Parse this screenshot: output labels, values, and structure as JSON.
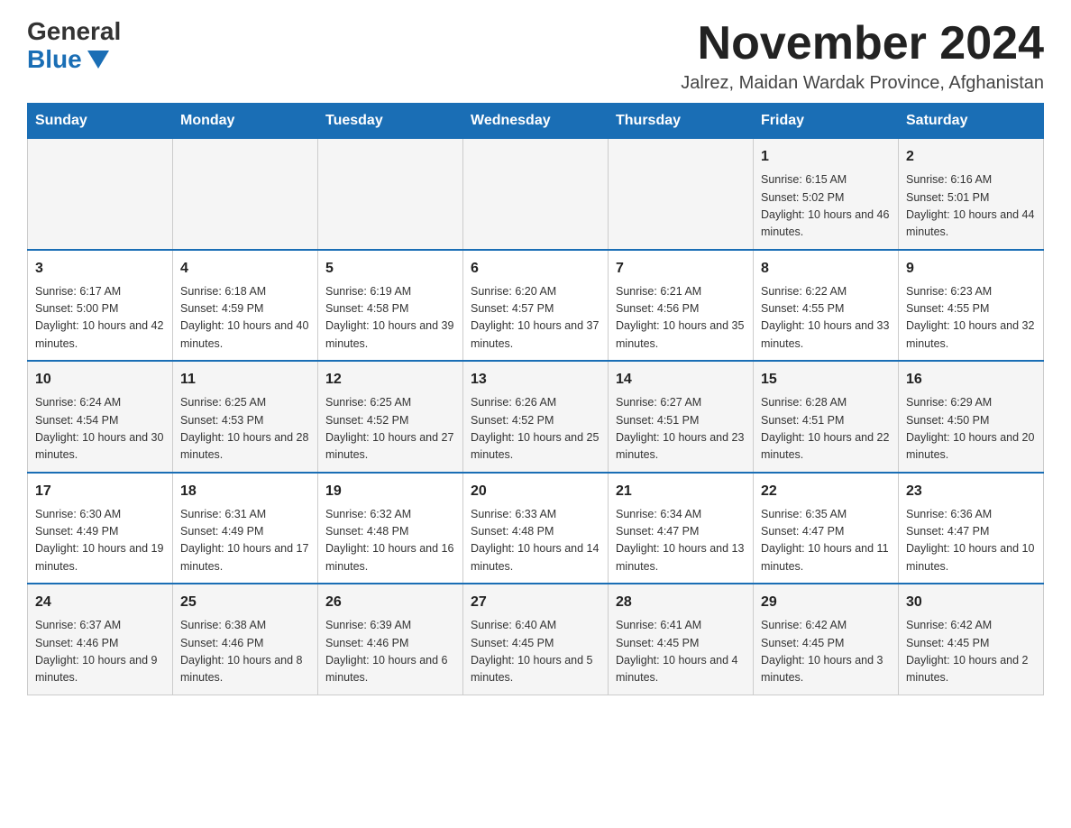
{
  "logo": {
    "general": "General",
    "blue": "Blue"
  },
  "header": {
    "month": "November 2024",
    "location": "Jalrez, Maidan Wardak Province, Afghanistan"
  },
  "days_of_week": [
    "Sunday",
    "Monday",
    "Tuesday",
    "Wednesday",
    "Thursday",
    "Friday",
    "Saturday"
  ],
  "weeks": [
    [
      {
        "day": "",
        "info": ""
      },
      {
        "day": "",
        "info": ""
      },
      {
        "day": "",
        "info": ""
      },
      {
        "day": "",
        "info": ""
      },
      {
        "day": "",
        "info": ""
      },
      {
        "day": "1",
        "info": "Sunrise: 6:15 AM\nSunset: 5:02 PM\nDaylight: 10 hours and 46 minutes."
      },
      {
        "day": "2",
        "info": "Sunrise: 6:16 AM\nSunset: 5:01 PM\nDaylight: 10 hours and 44 minutes."
      }
    ],
    [
      {
        "day": "3",
        "info": "Sunrise: 6:17 AM\nSunset: 5:00 PM\nDaylight: 10 hours and 42 minutes."
      },
      {
        "day": "4",
        "info": "Sunrise: 6:18 AM\nSunset: 4:59 PM\nDaylight: 10 hours and 40 minutes."
      },
      {
        "day": "5",
        "info": "Sunrise: 6:19 AM\nSunset: 4:58 PM\nDaylight: 10 hours and 39 minutes."
      },
      {
        "day": "6",
        "info": "Sunrise: 6:20 AM\nSunset: 4:57 PM\nDaylight: 10 hours and 37 minutes."
      },
      {
        "day": "7",
        "info": "Sunrise: 6:21 AM\nSunset: 4:56 PM\nDaylight: 10 hours and 35 minutes."
      },
      {
        "day": "8",
        "info": "Sunrise: 6:22 AM\nSunset: 4:55 PM\nDaylight: 10 hours and 33 minutes."
      },
      {
        "day": "9",
        "info": "Sunrise: 6:23 AM\nSunset: 4:55 PM\nDaylight: 10 hours and 32 minutes."
      }
    ],
    [
      {
        "day": "10",
        "info": "Sunrise: 6:24 AM\nSunset: 4:54 PM\nDaylight: 10 hours and 30 minutes."
      },
      {
        "day": "11",
        "info": "Sunrise: 6:25 AM\nSunset: 4:53 PM\nDaylight: 10 hours and 28 minutes."
      },
      {
        "day": "12",
        "info": "Sunrise: 6:25 AM\nSunset: 4:52 PM\nDaylight: 10 hours and 27 minutes."
      },
      {
        "day": "13",
        "info": "Sunrise: 6:26 AM\nSunset: 4:52 PM\nDaylight: 10 hours and 25 minutes."
      },
      {
        "day": "14",
        "info": "Sunrise: 6:27 AM\nSunset: 4:51 PM\nDaylight: 10 hours and 23 minutes."
      },
      {
        "day": "15",
        "info": "Sunrise: 6:28 AM\nSunset: 4:51 PM\nDaylight: 10 hours and 22 minutes."
      },
      {
        "day": "16",
        "info": "Sunrise: 6:29 AM\nSunset: 4:50 PM\nDaylight: 10 hours and 20 minutes."
      }
    ],
    [
      {
        "day": "17",
        "info": "Sunrise: 6:30 AM\nSunset: 4:49 PM\nDaylight: 10 hours and 19 minutes."
      },
      {
        "day": "18",
        "info": "Sunrise: 6:31 AM\nSunset: 4:49 PM\nDaylight: 10 hours and 17 minutes."
      },
      {
        "day": "19",
        "info": "Sunrise: 6:32 AM\nSunset: 4:48 PM\nDaylight: 10 hours and 16 minutes."
      },
      {
        "day": "20",
        "info": "Sunrise: 6:33 AM\nSunset: 4:48 PM\nDaylight: 10 hours and 14 minutes."
      },
      {
        "day": "21",
        "info": "Sunrise: 6:34 AM\nSunset: 4:47 PM\nDaylight: 10 hours and 13 minutes."
      },
      {
        "day": "22",
        "info": "Sunrise: 6:35 AM\nSunset: 4:47 PM\nDaylight: 10 hours and 11 minutes."
      },
      {
        "day": "23",
        "info": "Sunrise: 6:36 AM\nSunset: 4:47 PM\nDaylight: 10 hours and 10 minutes."
      }
    ],
    [
      {
        "day": "24",
        "info": "Sunrise: 6:37 AM\nSunset: 4:46 PM\nDaylight: 10 hours and 9 minutes."
      },
      {
        "day": "25",
        "info": "Sunrise: 6:38 AM\nSunset: 4:46 PM\nDaylight: 10 hours and 8 minutes."
      },
      {
        "day": "26",
        "info": "Sunrise: 6:39 AM\nSunset: 4:46 PM\nDaylight: 10 hours and 6 minutes."
      },
      {
        "day": "27",
        "info": "Sunrise: 6:40 AM\nSunset: 4:45 PM\nDaylight: 10 hours and 5 minutes."
      },
      {
        "day": "28",
        "info": "Sunrise: 6:41 AM\nSunset: 4:45 PM\nDaylight: 10 hours and 4 minutes."
      },
      {
        "day": "29",
        "info": "Sunrise: 6:42 AM\nSunset: 4:45 PM\nDaylight: 10 hours and 3 minutes."
      },
      {
        "day": "30",
        "info": "Sunrise: 6:42 AM\nSunset: 4:45 PM\nDaylight: 10 hours and 2 minutes."
      }
    ]
  ]
}
